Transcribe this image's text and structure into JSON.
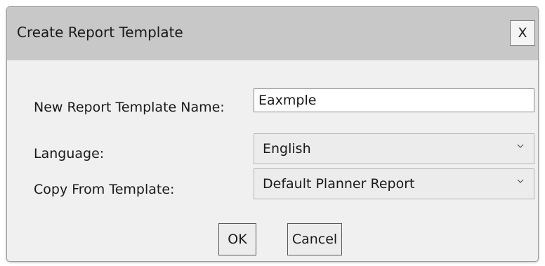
{
  "dialog": {
    "title": "Create Report Template",
    "close_label": "X"
  },
  "form": {
    "name_label": "New Report Template Name:",
    "name_value": "Eaxmple",
    "language_label": "Language:",
    "language_value": "English",
    "copy_label": "Copy From Template:",
    "copy_value": "Default Planner Report"
  },
  "buttons": {
    "ok_label": "OK",
    "cancel_label": "Cancel"
  },
  "icons": {
    "dropdown": "chevron-down-icon"
  },
  "colors": {
    "titlebar": "#c8c8c8",
    "body": "#f0f0f0"
  }
}
